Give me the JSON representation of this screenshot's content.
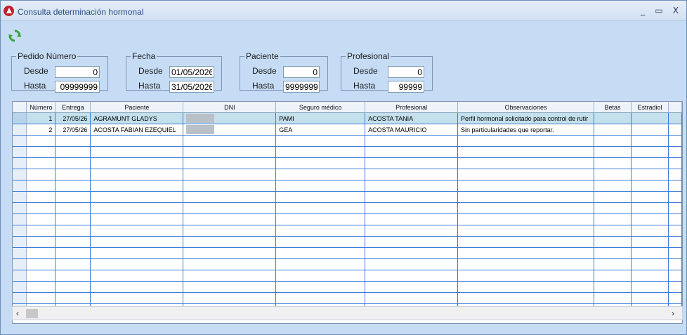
{
  "window": {
    "title": "Consulta determinación hormonal",
    "buttons": [
      "_",
      "▭",
      "X"
    ]
  },
  "toolbar": {
    "refresh_icon": "refresh-icon"
  },
  "filters": {
    "pedido": {
      "legend": "Pedido Número",
      "desde_label": "Desde",
      "desde": "0",
      "hasta_label": "Hasta",
      "hasta": "09999999"
    },
    "fecha": {
      "legend": "Fecha",
      "desde_label": "Desde",
      "desde": "01/05/2026",
      "hasta_label": "Hasta",
      "hasta": "31/05/2026"
    },
    "paciente": {
      "legend": "Paciente",
      "desde_label": "Desde",
      "desde": "0",
      "hasta_label": "Hasta",
      "hasta": "9999999"
    },
    "profesional": {
      "legend": "Profesional",
      "desde_label": "Desde",
      "desde": "0",
      "hasta_label": "Hasta",
      "hasta": "99999"
    }
  },
  "grid": {
    "columns": [
      "Número",
      "Entrega",
      "Paciente",
      "DNI",
      "Seguro médico",
      "Profesional",
      "Observaciones",
      "Betas",
      "Estradiol"
    ],
    "rows": [
      {
        "numero": "1",
        "entrega": "27/05/26",
        "paciente": "AGRAMUNT GLADYS",
        "seguro": "PAMI",
        "profesional": "ACOSTA TANIA",
        "observaciones": "Perfil hormonal solicitado para control de rutir",
        "betas": "",
        "estradiol": ""
      },
      {
        "numero": "2",
        "entrega": "27/05/26",
        "paciente": "ACOSTA FABIAN EZEQUIEL",
        "seguro": "GEA",
        "profesional": "ACOSTA MAURICIO",
        "observaciones": "Sin particularidades que reportar.",
        "betas": "",
        "estradiol": ""
      }
    ],
    "selected_row": 0
  },
  "scrollbar": {
    "left_arrow": "‹",
    "right_arrow": "›"
  }
}
